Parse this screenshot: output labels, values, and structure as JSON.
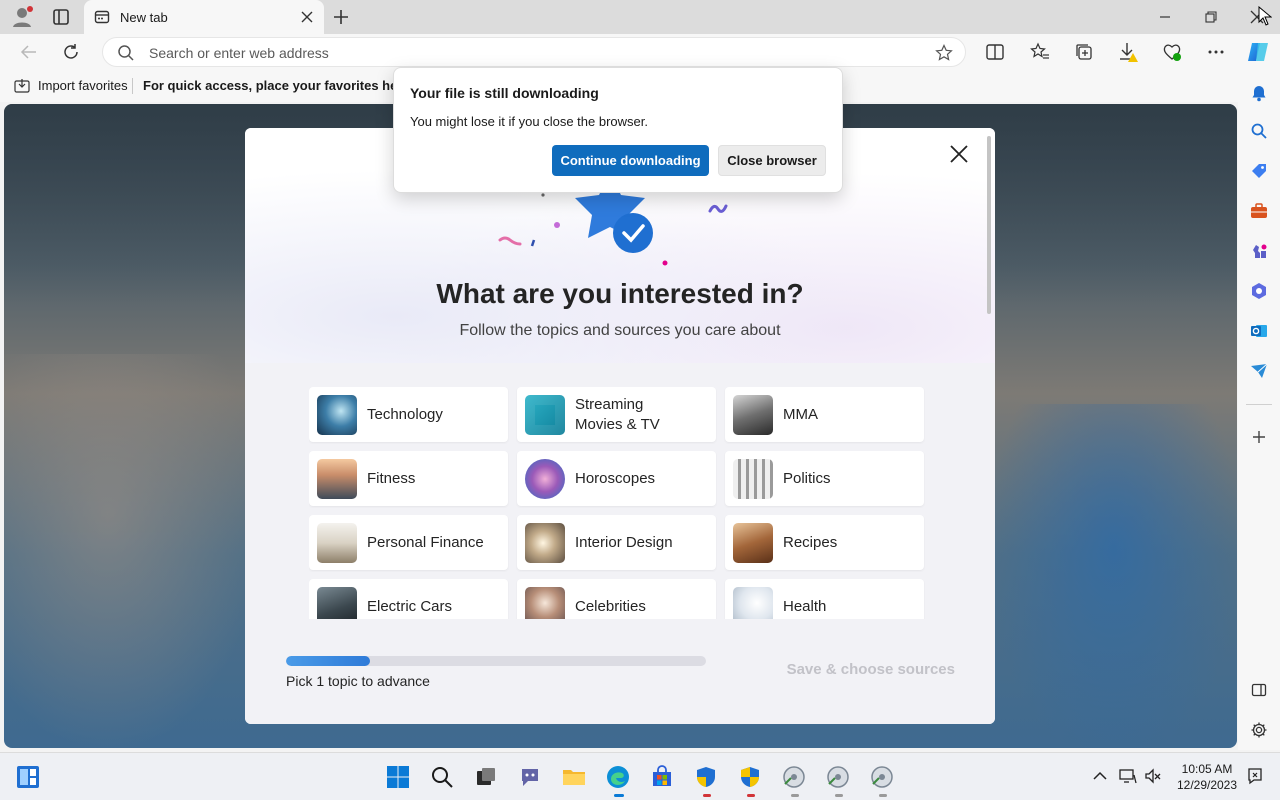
{
  "browser": {
    "tab_title": "New tab",
    "address_placeholder": "Search or enter web address",
    "favorites_bar": {
      "import_label": "Import favorites",
      "hint": "For quick access, place your favorites here on the favorites bar."
    }
  },
  "modal": {
    "title": "What are you interested in?",
    "subtitle": "Follow the topics and sources you care about",
    "topics": [
      {
        "label": "Technology",
        "icon": "technology-thumb"
      },
      {
        "label": "Streaming Movies & TV",
        "icon": "streaming-thumb"
      },
      {
        "label": "MMA",
        "icon": "mma-thumb"
      },
      {
        "label": "Fitness",
        "icon": "fitness-thumb"
      },
      {
        "label": "Horoscopes",
        "icon": "horoscopes-thumb"
      },
      {
        "label": "Politics",
        "icon": "politics-thumb"
      },
      {
        "label": "Personal Finance",
        "icon": "finance-thumb"
      },
      {
        "label": "Interior Design",
        "icon": "interior-thumb"
      },
      {
        "label": "Recipes",
        "icon": "recipes-thumb"
      },
      {
        "label": "Electric Cars",
        "icon": "cars-thumb"
      },
      {
        "label": "Celebrities",
        "icon": "celebrities-thumb"
      },
      {
        "label": "Health",
        "icon": "health-thumb"
      }
    ],
    "progress": {
      "fraction": 0.2,
      "label": "Pick 1 topic to advance"
    },
    "save_label": "Save & choose sources"
  },
  "popup": {
    "title": "Your file is still downloading",
    "message": "You might lose it if you close the browser.",
    "continue_label": "Continue downloading",
    "close_label": "Close browser"
  },
  "taskbar": {
    "time": "10:05 AM",
    "date": "12/29/2023"
  },
  "colors": {
    "accent": "#0f6cbd",
    "progress": "#3d8ee3"
  }
}
